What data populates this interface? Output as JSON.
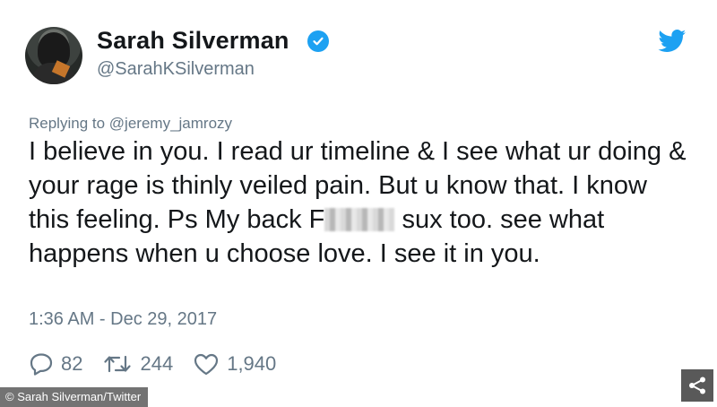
{
  "author": {
    "name": "Sarah Silverman",
    "handle": "@SarahKSilverman",
    "verified": true
  },
  "reply": {
    "prefix": "Replying to",
    "mention": "@jeremy_jamrozy"
  },
  "tweet": {
    "text_before_censor": "I believe in you. I read ur timeline & I see what ur doing & your rage is thinly veiled pain. But u know that. I know this feeling. Ps My back F",
    "text_after_censor": " sux too. see what happens when u choose love. I see it in you.",
    "timestamp": "1:36 AM - Dec 29, 2017"
  },
  "actions": {
    "replies": "82",
    "retweets": "244",
    "likes": "1,940"
  },
  "overlay": {
    "credit": "© Sarah Silverman/Twitter"
  },
  "colors": {
    "twitter_blue": "#1da1f2",
    "muted_text": "#657786",
    "body_text": "#14171a"
  },
  "icons": [
    "avatar",
    "verified-badge-icon",
    "twitter-bird-icon",
    "reply-icon",
    "retweet-icon",
    "like-icon",
    "share-icon"
  ]
}
